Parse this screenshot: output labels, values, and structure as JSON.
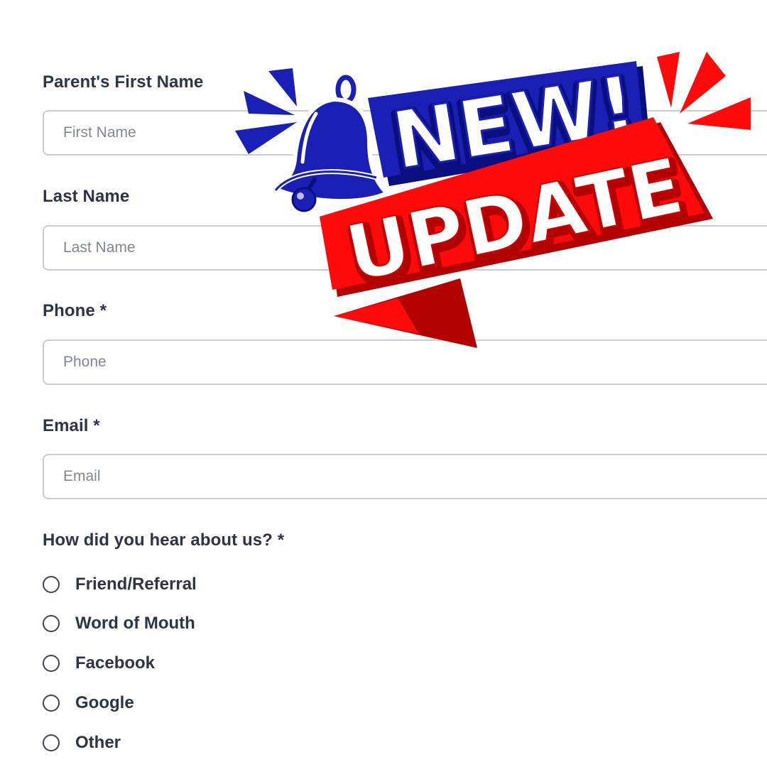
{
  "form": {
    "fields": [
      {
        "label": "Parent's First Name",
        "placeholder": "First Name"
      },
      {
        "label": "Last Name",
        "placeholder": "Last Name"
      },
      {
        "label": "Phone *",
        "placeholder": "Phone"
      },
      {
        "label": "Email *",
        "placeholder": "Email"
      }
    ],
    "referral": {
      "question": "How did you hear about us? *",
      "options": [
        "Friend/Referral",
        "Word of Mouth",
        "Facebook",
        "Google",
        "Other"
      ]
    }
  },
  "badge": {
    "line1": "NEW!",
    "line2": "UPDATE",
    "icon": "bell-icon",
    "colors": {
      "blue": "#1a1fb5",
      "dark_blue": "#0a0f80",
      "red": "#ff0a0a",
      "dark_red": "#b30000",
      "white": "#ffffff"
    }
  }
}
